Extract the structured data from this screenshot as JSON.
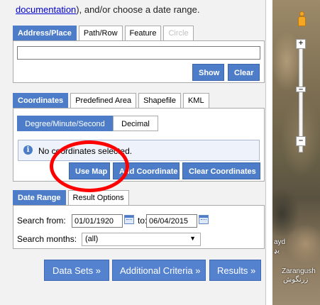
{
  "intro": {
    "link_text": "documentation",
    "text": "), and/or choose a date range."
  },
  "address_tabs": [
    {
      "label": "Address/Place",
      "state": "active"
    },
    {
      "label": "Path/Row",
      "state": "normal"
    },
    {
      "label": "Feature",
      "state": "normal"
    },
    {
      "label": "Circle",
      "state": "disabled"
    }
  ],
  "address_panel": {
    "input_value": "",
    "show_label": "Show",
    "clear_label": "Clear"
  },
  "coord_tabs": [
    {
      "label": "Coordinates",
      "state": "active"
    },
    {
      "label": "Predefined Area",
      "state": "normal"
    },
    {
      "label": "Shapefile",
      "state": "normal"
    },
    {
      "label": "KML",
      "state": "normal"
    }
  ],
  "coord_panel": {
    "format_options": [
      "Degree/Minute/Second",
      "Decimal"
    ],
    "selected_format": "Degree/Minute/Second",
    "notice": "No coordinates selected.",
    "use_map_label": "Use Map",
    "add_coord_label": "Add Coordinate",
    "clear_coords_label": "Clear Coordinates"
  },
  "date_tabs": [
    {
      "label": "Date Range",
      "state": "active"
    },
    {
      "label": "Result Options",
      "state": "normal"
    }
  ],
  "date_panel": {
    "search_from_label": "Search from:",
    "from_value": "01/01/1920",
    "to_label": "to:",
    "to_value": "06/04/2015",
    "months_label": "Search months:",
    "months_value": "(all)"
  },
  "nav": {
    "datasets": "Data Sets »",
    "criteria": "Additional Criteria »",
    "results": "Results »"
  },
  "map": {
    "labels": [
      "ayd",
      "یډ",
      "Zarangush",
      "زرنگوش"
    ]
  },
  "colors": {
    "accent": "#4d7dc8",
    "highlight": "#ff0000"
  }
}
